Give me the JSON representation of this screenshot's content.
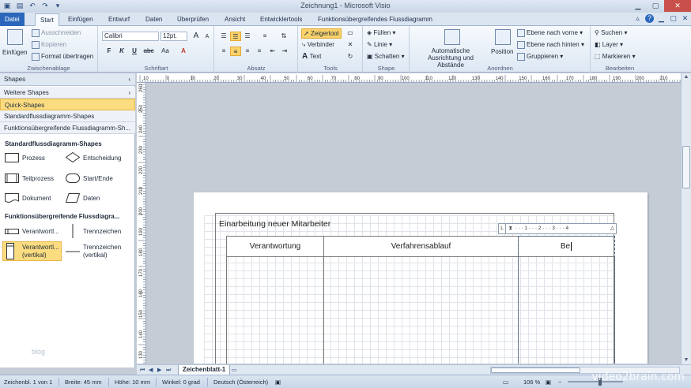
{
  "window": {
    "title": "Zeichnung1 - Microsoft Visio"
  },
  "tabs": [
    "Datei",
    "Start",
    "Einfügen",
    "Entwurf",
    "Daten",
    "Überprüfen",
    "Ansicht",
    "Entwicklertools",
    "Funktionsübergreifendes Flussdiagramm"
  ],
  "active_tab": "Start",
  "ribbon": {
    "clipboard": {
      "paste": "Einfügen",
      "cut": "Ausschneiden",
      "copy": "Kopieren",
      "format_painter": "Format übertragen",
      "label": "Zwischenablage"
    },
    "font": {
      "family": "Calibri",
      "size": "12pt.",
      "bold": "F",
      "italic": "K",
      "underline": "U",
      "strike": "abc",
      "case": "Aa",
      "grow": "A",
      "shrink": "A",
      "color": "A",
      "label": "Schriftart"
    },
    "paragraph": {
      "label": "Absatz"
    },
    "tools": {
      "pointer": "Zeigertool",
      "connector": "Verbinder",
      "text": "Text",
      "label": "Tools"
    },
    "shape": {
      "fill": "Füllen",
      "line": "Linie",
      "shadow": "Schatten",
      "label": "Shape"
    },
    "arrange": {
      "auto_align": "Automatische Ausrichtung und Abstände",
      "position": "Position",
      "bring_forward": "Ebene nach vorne",
      "send_backward": "Ebene nach hinten",
      "group": "Gruppieren",
      "label": "Anordnen"
    },
    "editing": {
      "find": "Suchen",
      "layer": "Layer",
      "select": "Markieren",
      "label": "Bearbeiten"
    }
  },
  "shapes_panel": {
    "title": "Shapes",
    "categories": [
      "Weitere Shapes",
      "Quick-Shapes",
      "Standardflussdiagramm-Shapes",
      "Funktionsübergreifende Flussdiagramm-Sh..."
    ],
    "selected_category": "Quick-Shapes",
    "section1": {
      "title": "Standardflussdiagramm-Shapes",
      "items": [
        "Prozess",
        "Entscheidung",
        "Teilprozess",
        "Start/Ende",
        "Dokument",
        "Daten"
      ]
    },
    "section2": {
      "title": "Funktionsübergreifende Flussdiagra...",
      "items": [
        "Verantwortl...",
        "Trennzeichen",
        "Verantwortl... (vertikal)",
        "Trennzeichen (vertikal)"
      ]
    },
    "watermark_text": "blog"
  },
  "ruler_top_labels": [
    "10",
    "0",
    "10",
    "20",
    "30",
    "40",
    "50",
    "60",
    "70",
    "80",
    "90",
    "100",
    "110",
    "120",
    "130",
    "140",
    "150",
    "160",
    "170",
    "180",
    "190",
    "200",
    "210",
    "220"
  ],
  "ruler_left_labels": [
    "260",
    "250",
    "240",
    "230",
    "220",
    "210",
    "200",
    "190",
    "180",
    "170",
    "160",
    "150",
    "140",
    "130"
  ],
  "diagram": {
    "title": "Einarbeitung neuer Mitarbeiter",
    "lanes": [
      "Verantwortung",
      "Verfahrensablauf",
      "Be"
    ],
    "mini_ruler": "· · · 1 · · · 2 · · · 3 · · · 4"
  },
  "sheet": {
    "tab": "Zeichenblatt-1"
  },
  "status": {
    "page": "Zeichenbl. 1 von 1",
    "width": "Breite: 45 mm",
    "height": "Höhe: 10 mm",
    "angle": "Winkel: 0 grad",
    "language": "Deutsch (Österreich)",
    "zoom": "106 %"
  },
  "brand_watermark": "video2brain.com"
}
